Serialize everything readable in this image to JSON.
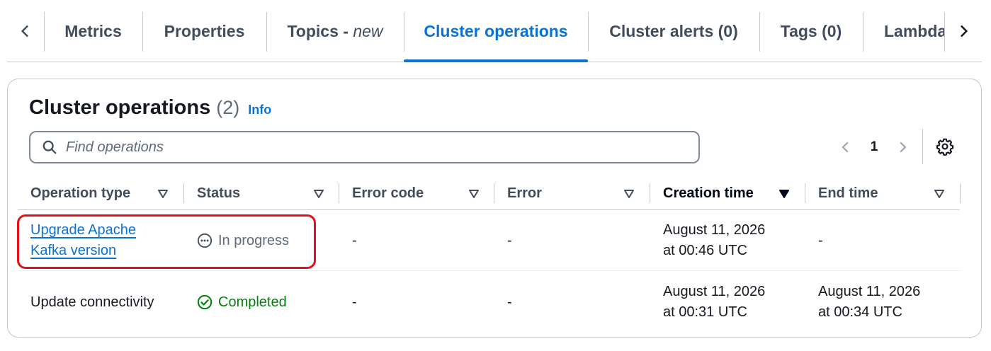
{
  "tabs": [
    {
      "label": "Metrics",
      "suffix": ""
    },
    {
      "label": "Properties",
      "suffix": ""
    },
    {
      "label": "Topics - ",
      "suffix": "new"
    },
    {
      "label": "Cluster operations",
      "suffix": ""
    },
    {
      "label": "Cluster alerts (0)",
      "suffix": ""
    },
    {
      "label": "Tags (0)",
      "suffix": ""
    },
    {
      "label": "Lambda",
      "suffix": ""
    }
  ],
  "active_tab": "Cluster operations",
  "section": {
    "title": "Cluster operations",
    "count": "(2)",
    "info_label": "Info"
  },
  "search": {
    "placeholder": "Find operations",
    "value": ""
  },
  "pagination": {
    "current_page": "1"
  },
  "table": {
    "columns": [
      {
        "label": "Operation type",
        "sorted": false
      },
      {
        "label": "Status",
        "sorted": false
      },
      {
        "label": "Error code",
        "sorted": false
      },
      {
        "label": "Error",
        "sorted": false
      },
      {
        "label": "Creation time",
        "sorted": true
      },
      {
        "label": "End time",
        "sorted": false
      }
    ],
    "rows": [
      {
        "operation_type_line1": "Upgrade Apache",
        "operation_type_line2": "Kafka version",
        "status": "In progress",
        "status_type": "in-progress",
        "error_code": "-",
        "error": "-",
        "creation_line1": "August 11, 2026",
        "creation_line2": "at 00:46 UTC",
        "end_line1": "-",
        "end_line2": ""
      },
      {
        "operation_type_line1": "Update connectivity",
        "operation_type_line2": "",
        "status": "Completed",
        "status_type": "success",
        "error_code": "-",
        "error": "-",
        "creation_line1": "August 11, 2026",
        "creation_line2": "at 00:31 UTC",
        "end_line1": "August 11, 2026",
        "end_line2": "at 00:34 UTC"
      }
    ]
  },
  "colors": {
    "accent": "#0972d3",
    "success": "#037f0c",
    "highlight": "#e0101c"
  }
}
